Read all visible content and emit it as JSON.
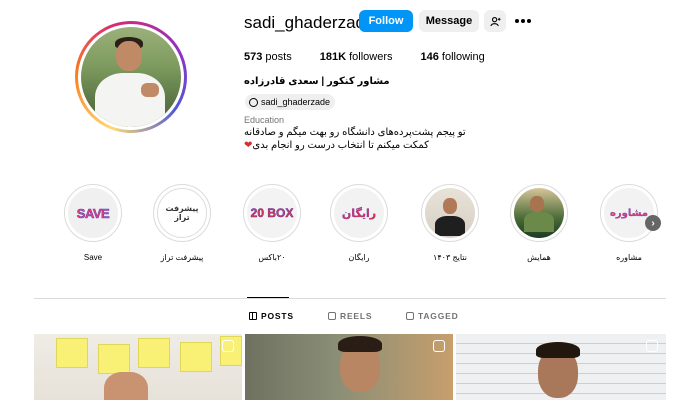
{
  "profile": {
    "username": "sadi_ghaderzade",
    "follow_label": "Follow",
    "message_label": "Message",
    "stats": {
      "posts_count": "573",
      "posts_label": "posts",
      "followers_count": "181K",
      "followers_label": "followers",
      "following_count": "146",
      "following_label": "following"
    },
    "full_name": "مشاور کنکور | سعدی قادرزاده",
    "threads_handle": "sadi_ghaderzade",
    "category": "Education",
    "bio_line1": "تو پیجم پشت‌پرده‌های دانشگاه رو بهت میگم و صادقانه",
    "bio_line2": "کمکت میکنم تا انتخاب درست رو انجام بدی",
    "bio_emoji": "❤"
  },
  "highlights": [
    {
      "label": "Save",
      "cover_text": "SAVE"
    },
    {
      "label": "پیشرفت تراز",
      "cover_text": "پیشرفت تراز"
    },
    {
      "label": "۲۰باکس",
      "cover_text": "20 BOX"
    },
    {
      "label": "رایگان",
      "cover_text": "رایگان"
    },
    {
      "label": "نتایج ۱۴۰۳",
      "cover_text": ""
    },
    {
      "label": "همایش",
      "cover_text": ""
    },
    {
      "label": "مشاوره",
      "cover_text": "مشاوره"
    }
  ],
  "tabs": [
    {
      "label": "POSTS"
    },
    {
      "label": "REELS"
    },
    {
      "label": "TAGGED"
    }
  ],
  "icons": {
    "more": "more-options-icon",
    "suggest": "add-person-icon",
    "next": "chevron-right-icon"
  },
  "colors": {
    "follow_button": "#0095f6",
    "secondary_button": "#efefef",
    "muted_text": "#737373",
    "heart": "#d62f2f"
  }
}
